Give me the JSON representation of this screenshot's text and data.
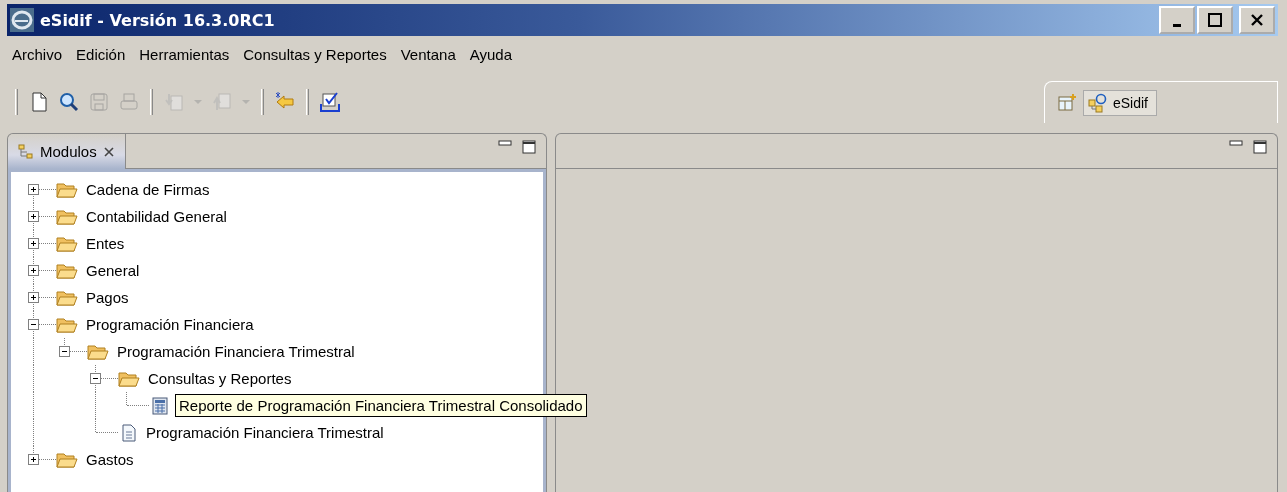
{
  "window": {
    "title": "eSidif - Versión 16.3.0RC1"
  },
  "menu": [
    "Archivo",
    "Edición",
    "Herramientas",
    "Consultas y Reportes",
    "Ventana",
    "Ayuda"
  ],
  "toolbar": [
    {
      "kind": "separator"
    },
    {
      "kind": "new",
      "disabled": false
    },
    {
      "kind": "search",
      "disabled": false
    },
    {
      "kind": "save",
      "disabled": true
    },
    {
      "kind": "print",
      "disabled": true
    },
    {
      "kind": "separator"
    },
    {
      "kind": "import",
      "disabled": true
    },
    {
      "kind": "dropdown",
      "disabled": true
    },
    {
      "kind": "export",
      "disabled": true
    },
    {
      "kind": "dropdown",
      "disabled": true
    },
    {
      "kind": "separator"
    },
    {
      "kind": "back",
      "disabled": false
    },
    {
      "kind": "separator"
    },
    {
      "kind": "checklist",
      "disabled": false
    }
  ],
  "perspectives": {
    "items": [
      {
        "label": "eSidif",
        "selected": true
      }
    ]
  },
  "modulos_view": {
    "tab": {
      "label": "Modulos",
      "selected": true
    },
    "tree": [
      {
        "label": "Cadena de Firmas",
        "kind": "folder",
        "expanded": false
      },
      {
        "label": "Contabilidad General",
        "kind": "folder",
        "expanded": false
      },
      {
        "label": "Entes",
        "kind": "folder",
        "expanded": false
      },
      {
        "label": "General",
        "kind": "folder",
        "expanded": false
      },
      {
        "label": "Pagos",
        "kind": "folder",
        "expanded": false
      },
      {
        "label": "Programación Financiera",
        "kind": "folder",
        "expanded": true,
        "children": [
          {
            "label": "Programación Financiera Trimestral",
            "kind": "folder",
            "expanded": true,
            "children": [
              {
                "label": "Consultas y Reportes",
                "kind": "folder",
                "expanded": true,
                "children": [
                  {
                    "label": "Reporte de Programación Financiera Trimestral Consolidado",
                    "kind": "report",
                    "hovered": true
                  }
                ]
              },
              {
                "label": "Programación Financiera Trimestral",
                "kind": "document",
                "hovered": false
              }
            ]
          }
        ]
      },
      {
        "label": "Gastos",
        "kind": "folder",
        "expanded": false
      }
    ]
  }
}
